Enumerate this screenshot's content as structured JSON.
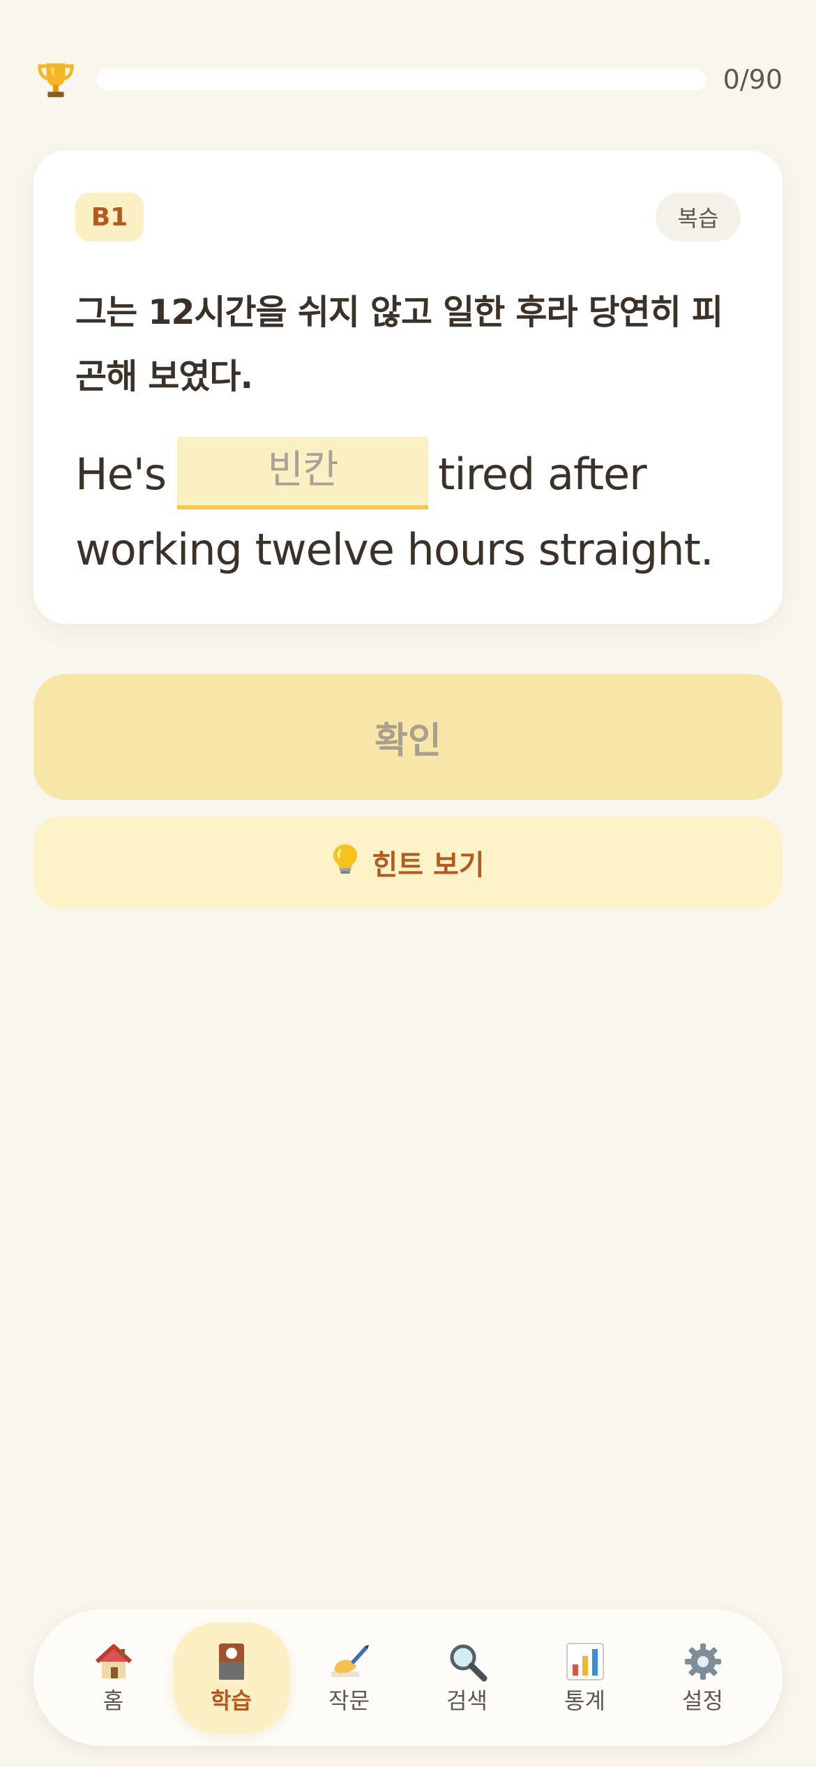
{
  "progress": {
    "count_text": "0/90",
    "fraction": 0,
    "icon": "trophy-icon"
  },
  "card": {
    "level": "B1",
    "review_label": "복습",
    "korean": "그는 12시간을 쉬지 않고 일한 후라 당연히 피곤해 보였다.",
    "english_before": "He's",
    "blank_placeholder": "빈칸",
    "english_after": "tired after working twelve hours straight."
  },
  "actions": {
    "confirm_label": "확인",
    "hint_label": "힌트 보기",
    "hint_icon": "lightbulb-icon"
  },
  "nav": {
    "items": [
      {
        "label": "홈",
        "icon": "house-icon"
      },
      {
        "label": "학습",
        "icon": "flashcard-icon",
        "active": true
      },
      {
        "label": "작문",
        "icon": "writing-hand-icon"
      },
      {
        "label": "검색",
        "icon": "magnifier-icon"
      },
      {
        "label": "통계",
        "icon": "bar-chart-icon"
      },
      {
        "label": "설정",
        "icon": "gear-icon"
      }
    ]
  },
  "colors": {
    "background": "#f9f6ee",
    "accent": "#f2c94c",
    "accent_text": "#b55a1e",
    "confirm_disabled": "#f8e6a8",
    "hint_bg": "#fdf2c8"
  }
}
